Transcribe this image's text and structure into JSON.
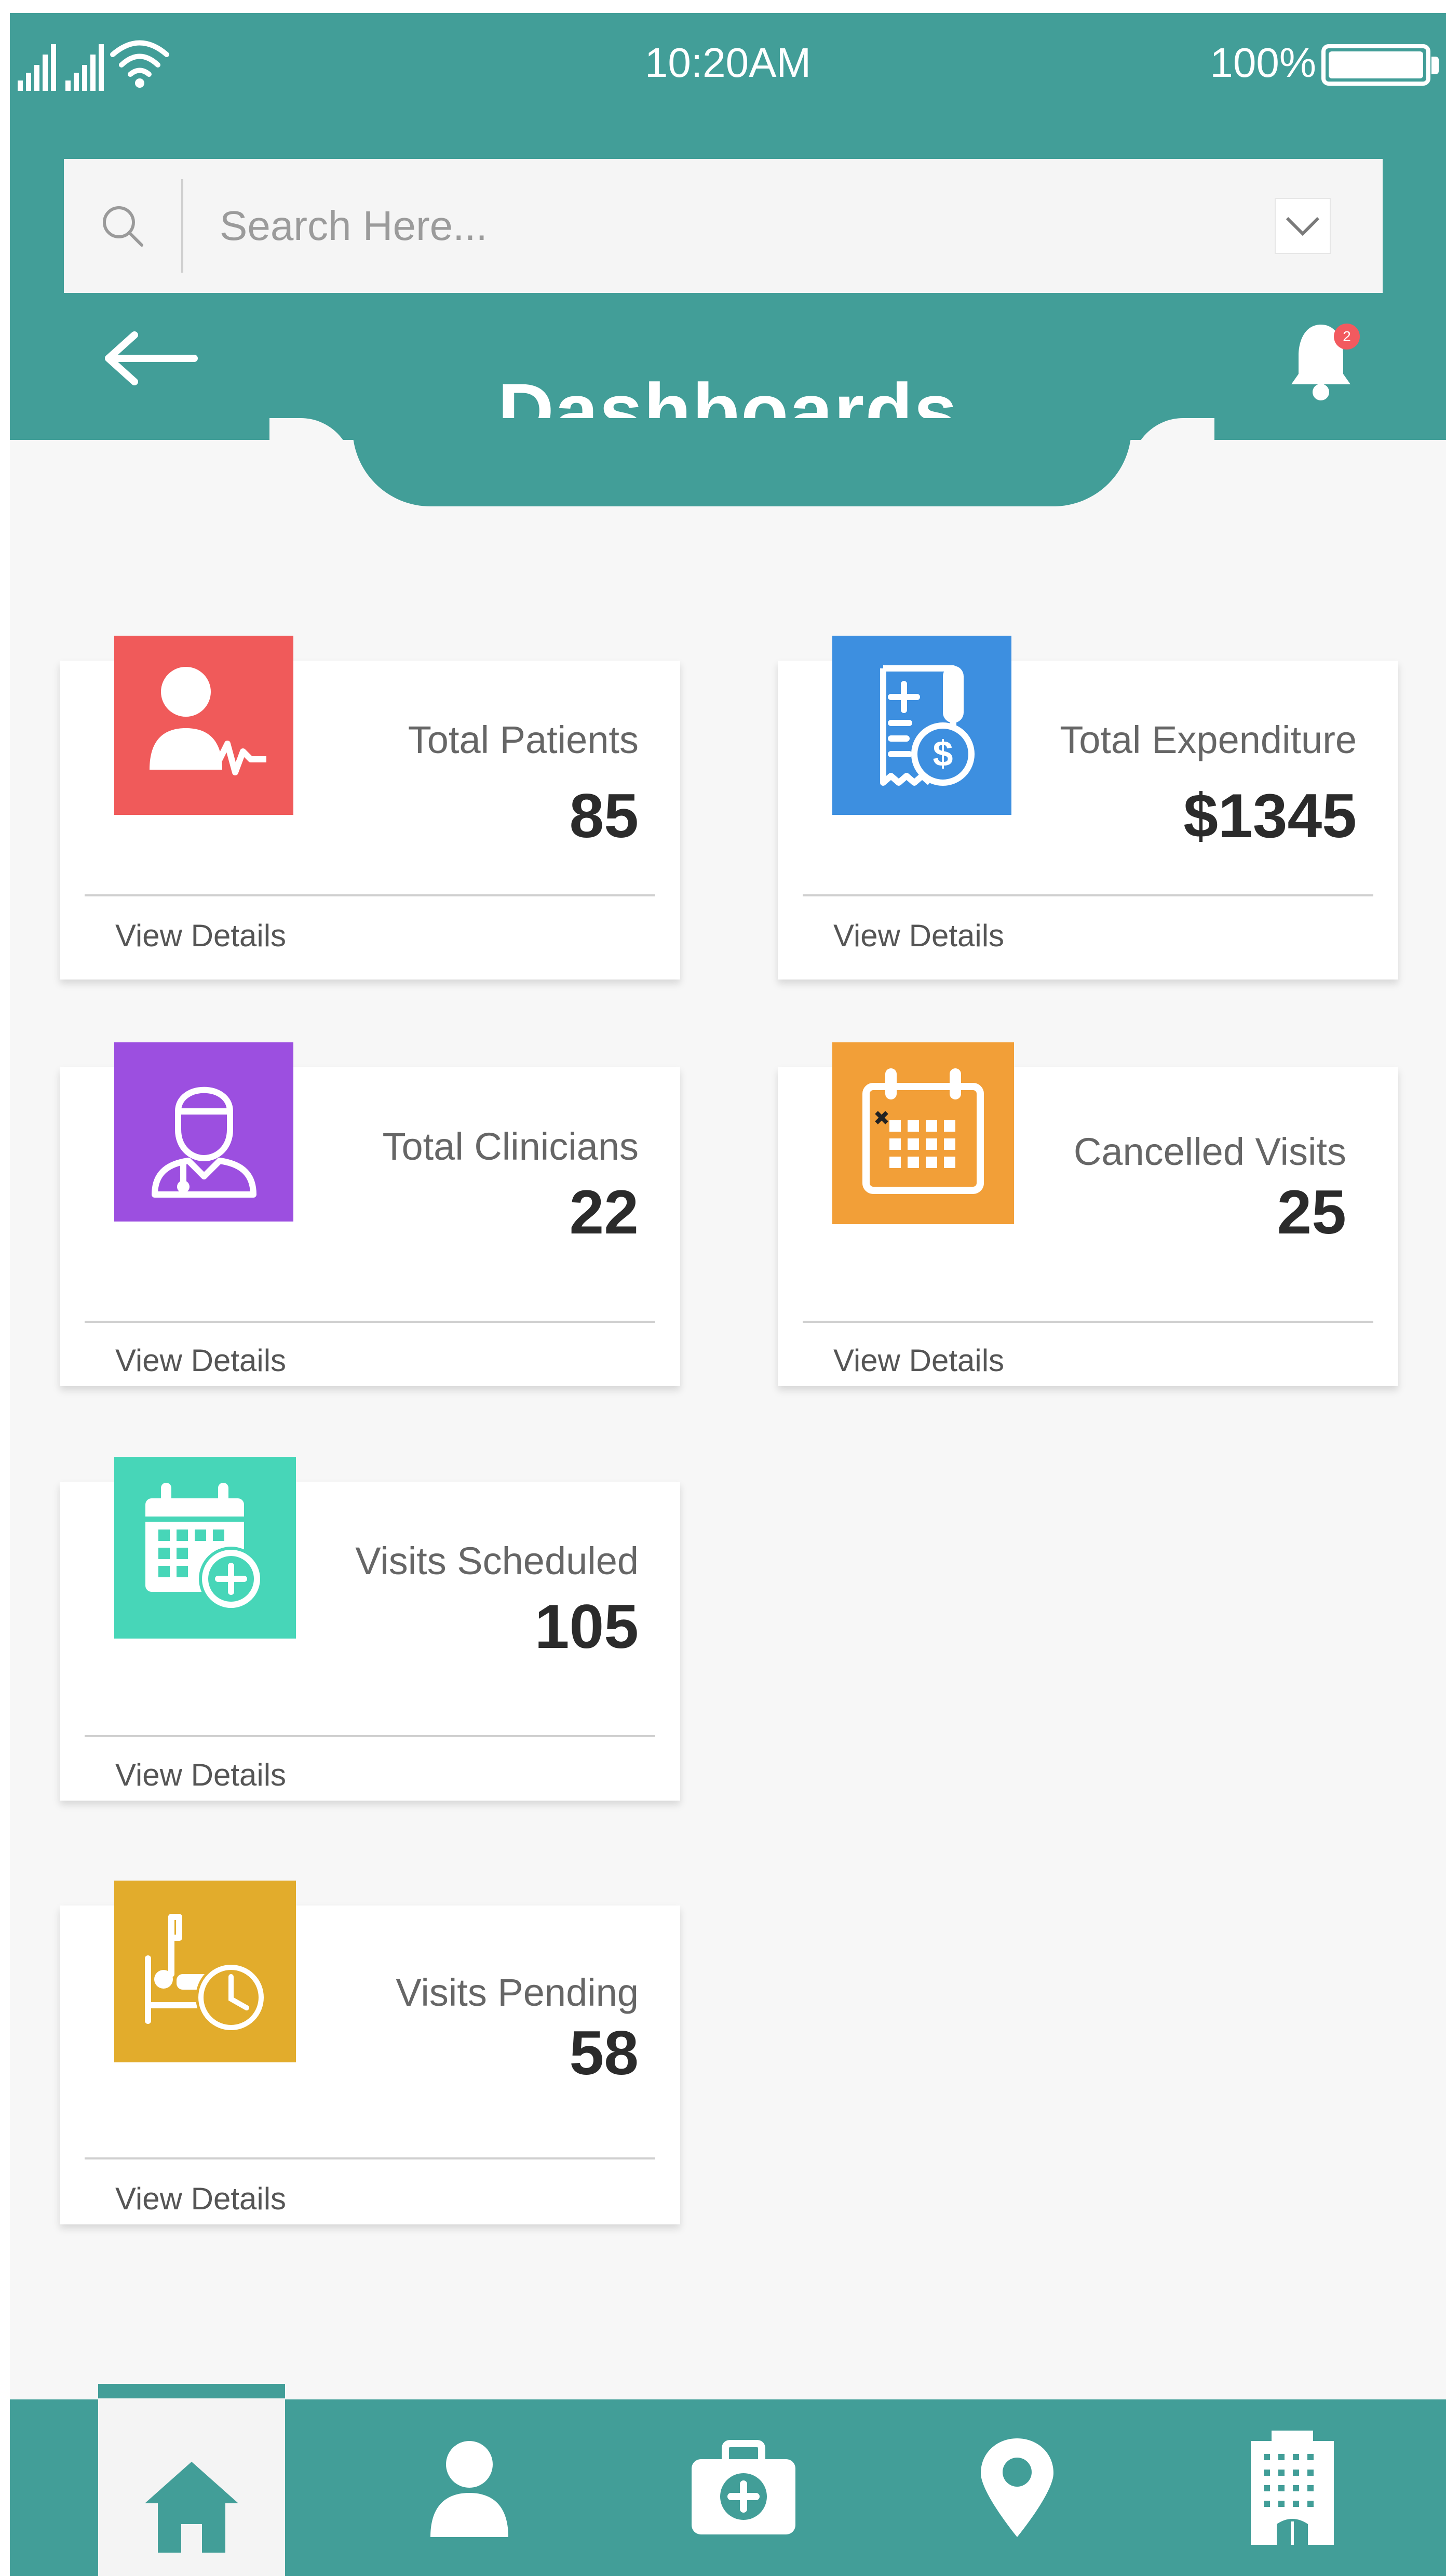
{
  "status_bar": {
    "time": "10:20AM",
    "battery": "100%"
  },
  "search": {
    "placeholder": "Search Here..."
  },
  "header": {
    "title": "Dashboards",
    "notification_count": "2"
  },
  "cards": [
    {
      "label": "Total Patients",
      "value": "85",
      "link": "View Details",
      "icon": "patient-monitor-icon",
      "color": "#f05a5a"
    },
    {
      "label": "Total Expenditure",
      "value": "$1345",
      "link": "View Details",
      "icon": "receipt-dollar-icon",
      "color": "#3d8fe0"
    },
    {
      "label": "Total Clinicians",
      "value": "22",
      "link": "View Details",
      "icon": "doctor-icon",
      "color": "#9c4fe0"
    },
    {
      "label": "Cancelled Visits",
      "value": "25",
      "link": "View Details",
      "icon": "calendar-cancel-icon",
      "color": "#f29f38"
    },
    {
      "label": "Visits Scheduled",
      "value": "105",
      "link": "View Details",
      "icon": "calendar-add-icon",
      "color": "#47d6b8"
    },
    {
      "label": "Visits Pending",
      "value": "58",
      "link": "View Details",
      "icon": "hospital-bed-clock-icon",
      "color": "#e2ac2c"
    }
  ],
  "bottom_nav": [
    {
      "icon": "home-icon",
      "active": true
    },
    {
      "icon": "user-icon",
      "active": false
    },
    {
      "icon": "medical-kit-icon",
      "active": false
    },
    {
      "icon": "location-pin-icon",
      "active": false
    },
    {
      "icon": "building-icon",
      "active": false
    }
  ],
  "colors": {
    "primary": "#429e98",
    "background": "#f7f7f7",
    "badge": "#f25a5f"
  }
}
